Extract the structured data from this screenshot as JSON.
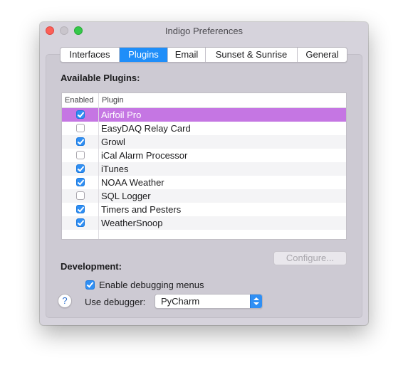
{
  "window": {
    "title": "Indigo Preferences"
  },
  "tabs": [
    {
      "label": "Interfaces",
      "selected": false
    },
    {
      "label": "Plugins",
      "selected": true
    },
    {
      "label": "Email",
      "selected": false
    },
    {
      "label": "Sunset & Sunrise",
      "selected": false
    },
    {
      "label": "General",
      "selected": false
    }
  ],
  "plugins_section": {
    "title": "Available Plugins:",
    "columns": {
      "enabled": "Enabled",
      "plugin": "Plugin"
    },
    "rows": [
      {
        "name": "Airfoil Pro",
        "enabled": true,
        "selected": true
      },
      {
        "name": "EasyDAQ Relay Card",
        "enabled": false,
        "selected": false
      },
      {
        "name": "Growl",
        "enabled": true,
        "selected": false
      },
      {
        "name": "iCal Alarm Processor",
        "enabled": false,
        "selected": false
      },
      {
        "name": "iTunes",
        "enabled": true,
        "selected": false
      },
      {
        "name": "NOAA Weather",
        "enabled": true,
        "selected": false
      },
      {
        "name": "SQL Logger",
        "enabled": false,
        "selected": false
      },
      {
        "name": "Timers and Pesters",
        "enabled": true,
        "selected": false
      },
      {
        "name": "WeatherSnoop",
        "enabled": true,
        "selected": false
      }
    ],
    "configure_label": "Configure..."
  },
  "development": {
    "title": "Development:",
    "enable_debugging_label": "Enable debugging menus",
    "enable_debugging_checked": true,
    "debugger_label": "Use debugger:",
    "debugger_value": "PyCharm",
    "help_label": "?"
  },
  "colors": {
    "accent": "#1f8ef9",
    "selected_row": "#c576e3",
    "window_bg": "#d6d3dc"
  },
  "icons": {
    "close": "close-icon",
    "minimize": "minimize-icon",
    "maximize": "maximize-icon",
    "popup_arrows": "chevron-updown-icon",
    "help": "question-mark-icon"
  }
}
